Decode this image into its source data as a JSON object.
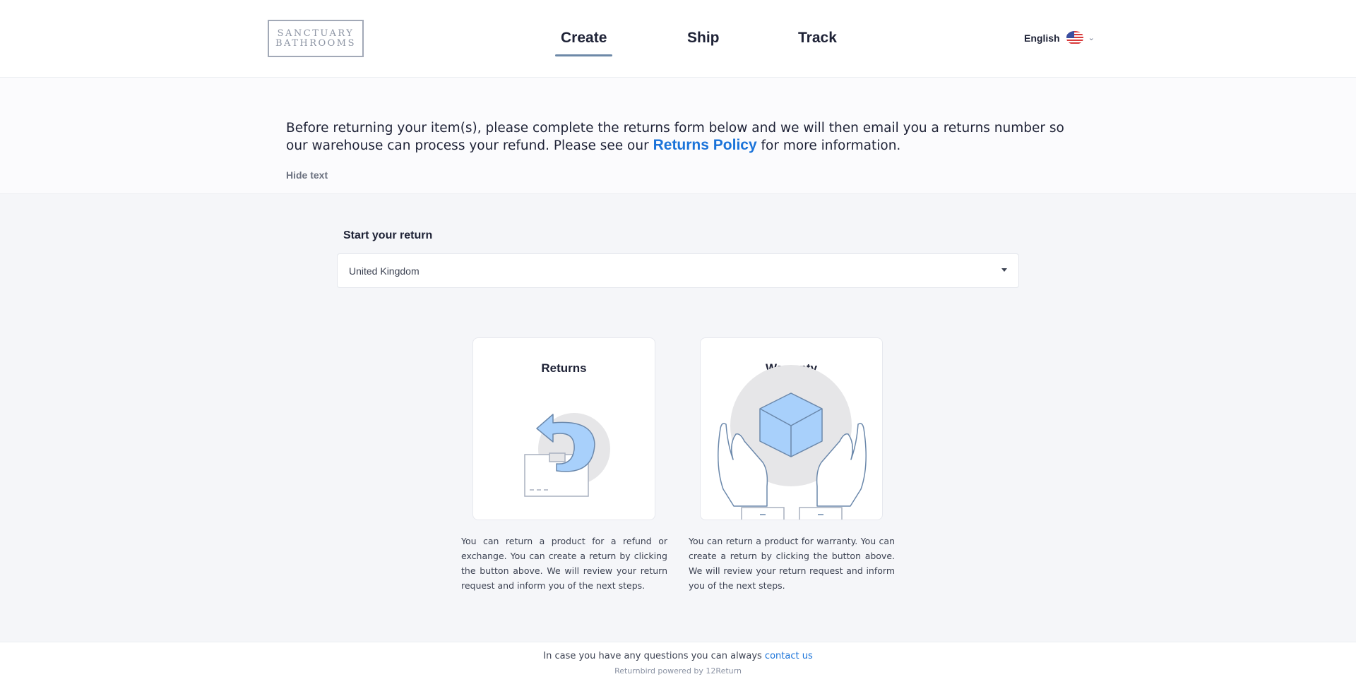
{
  "header": {
    "logo_line1": "SANCTUARY",
    "logo_line2": "BATHROOMS",
    "tabs": [
      {
        "label": "Create",
        "active": true
      },
      {
        "label": "Ship",
        "active": false
      },
      {
        "label": "Track",
        "active": false
      }
    ],
    "language": "English",
    "flag_icon": "us-flag-icon"
  },
  "intro": {
    "text_before": "Before returning your item(s), please complete the returns form below and we will then email you a returns number so our warehouse can process your refund. Please see our ",
    "policy_link": "Returns Policy",
    "text_after": " for more information.",
    "hide_label": "Hide text"
  },
  "start": {
    "label": "Start your return",
    "country": "United Kingdom"
  },
  "cards": [
    {
      "title": "Returns",
      "icon": "return-box-icon",
      "description": "You can return a product for a refund or exchange. You can create a return by clicking the button above. We will review your return request and inform you of the next steps."
    },
    {
      "title": "Warranty",
      "icon": "warranty-hands-box-icon",
      "description": "You can return a product for warranty. You can create a return by clicking the button above. We will review your return request and inform you of the next steps."
    }
  ],
  "footer": {
    "text": "In case you have any questions you can always ",
    "contact_link": "contact us",
    "powered": "Returnbird powered by 12Return"
  },
  "colors": {
    "accent": "#1a73d9",
    "tab_underline": "#6d89a8",
    "icon_fill": "#a8d0fb",
    "icon_stroke": "#6b88ab"
  }
}
